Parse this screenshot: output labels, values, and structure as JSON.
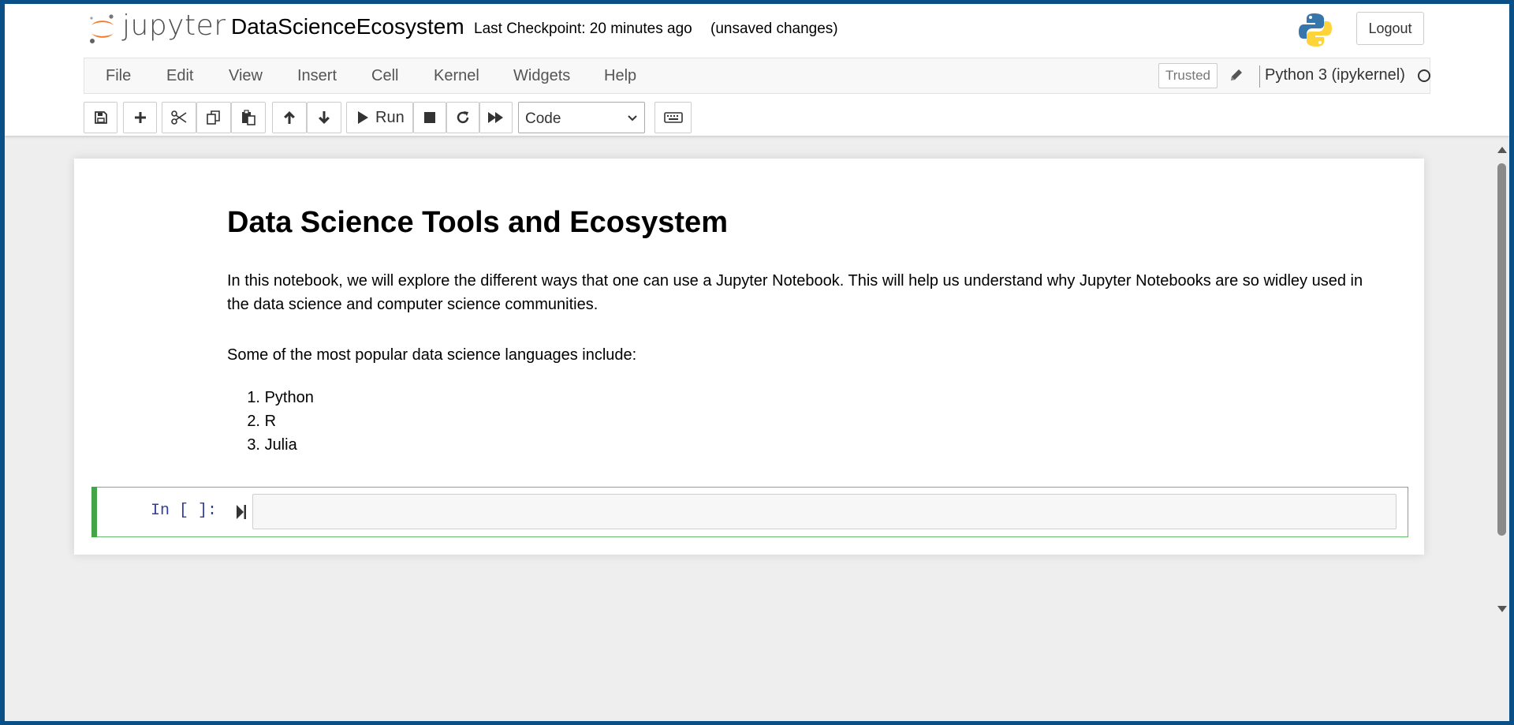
{
  "header": {
    "logo_text": "jupyter",
    "notebook_title": "DataScienceEcosystem",
    "checkpoint": "Last Checkpoint: 20 minutes ago",
    "autosave_status": "(unsaved changes)",
    "logout_label": "Logout"
  },
  "menubar": {
    "items": [
      "File",
      "Edit",
      "View",
      "Insert",
      "Cell",
      "Kernel",
      "Widgets",
      "Help"
    ],
    "trusted_label": "Trusted",
    "kernel_name": "Python 3 (ipykernel)"
  },
  "toolbar": {
    "run_label": "Run",
    "cell_type": "Code",
    "buttons": [
      "save-icon",
      "plus-icon",
      "cut-icon",
      "copy-icon",
      "paste-icon",
      "arrow-up-icon",
      "arrow-down-icon",
      "play-icon",
      "stop-icon",
      "restart-icon",
      "fast-forward-icon",
      "keyboard-icon"
    ]
  },
  "notebook": {
    "heading": "Data Science Tools and Ecosystem",
    "intro": "In this notebook, we will explore the different ways that one can use a Jupyter Notebook. This will help us understand why Jupyter Notebooks are so widley used in the data science and computer science communities.",
    "languages_intro": "Some of the most popular data science languages include:",
    "languages": [
      {
        "num": "1.",
        "name": "Python"
      },
      {
        "num": "2.",
        "name": "R"
      },
      {
        "num": "3.",
        "name": "Julia"
      }
    ],
    "code_cell": {
      "prompt": "In [ ]:",
      "content": ""
    }
  },
  "colors": {
    "accent_green": "#42a548",
    "prompt_blue": "#303f9f",
    "jupyter_orange": "#f37726",
    "window_border": "#0b4f87"
  }
}
